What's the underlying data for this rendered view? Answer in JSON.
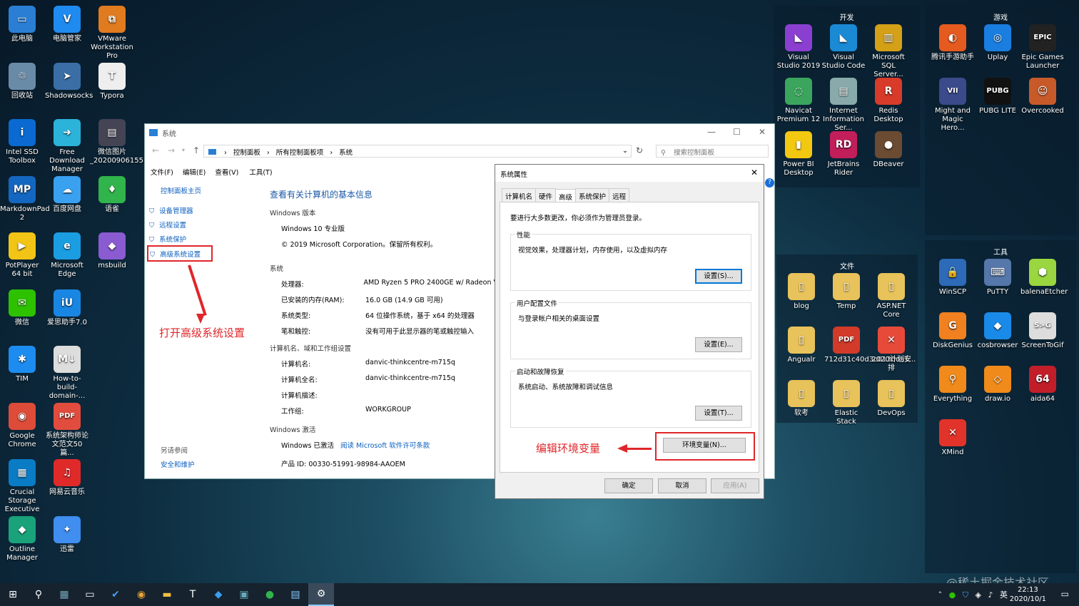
{
  "desktop": {
    "icons": [
      {
        "label": "此电脑",
        "color": "#2a7fd4",
        "glyph": "▭"
      },
      {
        "label": "电脑管家",
        "color": "#1f8bf0",
        "glyph": "V"
      },
      {
        "label": "VMware Workstation Pro",
        "color": "#e07b20",
        "glyph": "⧉"
      },
      {
        "label": "回收站",
        "color": "#6a8ba8",
        "glyph": "♲"
      },
      {
        "label": "Shadowsocks",
        "color": "#3a6ea5",
        "glyph": "➤"
      },
      {
        "label": "Typora",
        "color": "#eeeeee",
        "glyph": "T"
      },
      {
        "label": "Intel SSD Toolbox",
        "color": "#0a6ad1",
        "glyph": "i"
      },
      {
        "label": "Free Download Manager",
        "color": "#2bb3d9",
        "glyph": "➜"
      },
      {
        "label": "微信图片_20200906155...",
        "color": "#445",
        "glyph": "▤"
      },
      {
        "label": "MarkdownPad 2",
        "color": "#1467c0",
        "glyph": "MP"
      },
      {
        "label": "百度网盘",
        "color": "#3aa0f0",
        "glyph": "☁"
      },
      {
        "label": "语雀",
        "color": "#31b44b",
        "glyph": "♦"
      },
      {
        "label": "PotPlayer 64 bit",
        "color": "#f2c416",
        "glyph": "▶"
      },
      {
        "label": "Microsoft Edge",
        "color": "#1b9de2",
        "glyph": "e"
      },
      {
        "label": "msbuild",
        "color": "#8a5bd1",
        "glyph": "◆"
      },
      {
        "label": "微信",
        "color": "#2dc100",
        "glyph": "✉"
      },
      {
        "label": "爱思助手7.0",
        "color": "#1a86e3",
        "glyph": "iU"
      },
      {
        "label": "TIM",
        "color": "#1d8cf0",
        "glyph": "✱"
      },
      {
        "label": "How-to-build-domain-...",
        "color": "#ddd",
        "glyph": "M↓"
      },
      {
        "label": "Google Chrome",
        "color": "#dd4b39",
        "glyph": "◉"
      },
      {
        "label": "系统架构师论文范文50篇...",
        "color": "#e24c3e",
        "glyph": "PDF"
      },
      {
        "label": "Crucial Storage Executive",
        "color": "#0a7bc5",
        "glyph": "▦"
      },
      {
        "label": "网易云音乐",
        "color": "#e02a2a",
        "glyph": "♫"
      },
      {
        "label": "Outline Manager",
        "color": "#1aa37b",
        "glyph": "◆"
      },
      {
        "label": "迅雷",
        "color": "#3f8ef0",
        "glyph": "✦"
      }
    ]
  },
  "groups": {
    "dev": {
      "title": "开发",
      "items": [
        {
          "label": "Visual Studio 2019",
          "color": "#8a3fd1",
          "glyph": "◣"
        },
        {
          "label": "Visual Studio Code",
          "color": "#1a8ad4",
          "glyph": "◣"
        },
        {
          "label": "Microsoft SQL Server...",
          "color": "#d4a017",
          "glyph": "▥"
        },
        {
          "label": "Navicat Premium 12",
          "color": "#3ba55d",
          "glyph": "◌"
        },
        {
          "label": "Internet Information Ser...",
          "color": "#8aa",
          "glyph": "▤"
        },
        {
          "label": "Redis Desktop",
          "color": "#d83b2a",
          "glyph": "R"
        },
        {
          "label": "Power BI Desktop",
          "color": "#f2c811",
          "glyph": "▮"
        },
        {
          "label": "JetBrains Rider",
          "color": "#c21e5a",
          "glyph": "RD"
        },
        {
          "label": "DBeaver",
          "color": "#6b4b32",
          "glyph": "●"
        }
      ]
    },
    "games": {
      "title": "游戏",
      "items": [
        {
          "label": "腾讯手游助手",
          "color": "#e55a1f",
          "glyph": "◐"
        },
        {
          "label": "Uplay",
          "color": "#1a7ee0",
          "glyph": "◎"
        },
        {
          "label": "Epic Games Launcher",
          "color": "#222",
          "glyph": "EPIC"
        },
        {
          "label": "Might and Magic Hero...",
          "color": "#3a4a8a",
          "glyph": "VII"
        },
        {
          "label": "PUBG LITE",
          "color": "#111",
          "glyph": "PUBG"
        },
        {
          "label": "Overcooked",
          "color": "#c85a2a",
          "glyph": "☺"
        }
      ]
    },
    "files": {
      "title": "文件",
      "items": [
        {
          "label": "blog",
          "color": "#e8c25a",
          "glyph": "▯"
        },
        {
          "label": "Temp",
          "color": "#e8c25a",
          "glyph": "▯"
        },
        {
          "label": "ASP.NET Core",
          "color": "#e8c25a",
          "glyph": "▯"
        },
        {
          "label": "Angualr",
          "color": "#e8c25a",
          "glyph": "▯"
        },
        {
          "label": "712d31c40d3c0130ea1...",
          "color": "#d23a2a",
          "glyph": "PDF"
        },
        {
          "label": "2020计划安排",
          "color": "#e84a3a",
          "glyph": "✕"
        },
        {
          "label": "软考",
          "color": "#e8c25a",
          "glyph": "▯"
        },
        {
          "label": "Elastic Stack",
          "color": "#e8c25a",
          "glyph": "▯"
        },
        {
          "label": "DevOps",
          "color": "#e8c25a",
          "glyph": "▯"
        }
      ]
    },
    "tools": {
      "title": "工具",
      "items": [
        {
          "label": "WinSCP",
          "color": "#2d6ab8",
          "glyph": "🔒"
        },
        {
          "label": "PuTTY",
          "color": "#5577aa",
          "glyph": "⌨"
        },
        {
          "label": "balenaEtcher",
          "color": "#9ad640",
          "glyph": "⬢"
        },
        {
          "label": "DiskGenius",
          "color": "#f08020",
          "glyph": "G"
        },
        {
          "label": "cosbrowser",
          "color": "#1a8ae8",
          "glyph": "◆"
        },
        {
          "label": "ScreenToGif",
          "color": "#ddd",
          "glyph": "S>G"
        },
        {
          "label": "Everything",
          "color": "#f08a1a",
          "glyph": "⚲"
        },
        {
          "label": "draw.io",
          "color": "#f08a1a",
          "glyph": "◇"
        },
        {
          "label": "aida64",
          "color": "#c21e2a",
          "glyph": "64"
        },
        {
          "label": "XMind",
          "color": "#e2332a",
          "glyph": "✕"
        }
      ]
    }
  },
  "system_window": {
    "title": "系统",
    "address": {
      "part1": "控制面板",
      "part2": "所有控制面板项",
      "part3": "系统"
    },
    "search_placeholder": "搜索控制面板",
    "menu": [
      "文件(F)",
      "编辑(E)",
      "查看(V)",
      "工具(T)"
    ],
    "sidebar": {
      "home": "控制面板主页",
      "items": [
        "设备管理器",
        "远程设置",
        "系统保护",
        "高级系统设置"
      ],
      "see_also": "另请参阅",
      "security": "安全和维护"
    },
    "heading": "查看有关计算机的基本信息",
    "edition_header": "Windows 版本",
    "edition": "Windows 10 专业版",
    "copyright": "© 2019 Microsoft Corporation。保留所有权利。",
    "system_header": "系统",
    "system_rows": [
      {
        "k": "处理器:",
        "v": "AMD Ryzen 5 PRO 2400GE w/ Radeon V"
      },
      {
        "k": "已安装的内存(RAM):",
        "v": "16.0 GB (14.9 GB 可用)"
      },
      {
        "k": "系统类型:",
        "v": "64 位操作系统，基于 x64 的处理器"
      },
      {
        "k": "笔和触控:",
        "v": "没有可用于此显示器的笔或触控输入"
      }
    ],
    "computer_header": "计算机名、域和工作组设置",
    "computer_rows": [
      {
        "k": "计算机名:",
        "v": "danvic-thinkcentre-m715q"
      },
      {
        "k": "计算机全名:",
        "v": "danvic-thinkcentre-m715q"
      },
      {
        "k": "计算机描述:",
        "v": ""
      },
      {
        "k": "工作组:",
        "v": "WORKGROUP"
      }
    ],
    "activation_header": "Windows 激活",
    "activated": "Windows 已激活",
    "license_link": "阅读 Microsoft 软件许可条款",
    "product_id": "产品 ID: 00330-51991-98984-AAOEM",
    "annotation": "打开高级系统设置"
  },
  "props_dialog": {
    "title": "系统属性",
    "tabs": [
      "计算机名",
      "硬件",
      "高级",
      "系统保护",
      "远程"
    ],
    "admin_note": "要进行大多数更改，你必须作为管理员登录。",
    "perf": {
      "legend": "性能",
      "desc": "视觉效果，处理器计划，内存使用，以及虚拟内存",
      "button": "设置(S)..."
    },
    "profile": {
      "legend": "用户配置文件",
      "desc": "与登录帐户相关的桌面设置",
      "button": "设置(E)..."
    },
    "startup": {
      "legend": "启动和故障恢复",
      "desc": "系统启动、系统故障和调试信息",
      "button": "设置(T)..."
    },
    "env_button": "环境变量(N)...",
    "annotation": "编辑环境变量",
    "ok": "确定",
    "cancel": "取消",
    "apply": "应用(A)"
  },
  "taskbar": {
    "clock_time": "22:13",
    "clock_date": "2020/10/1",
    "ime": "英",
    "watermark": "@稀土掘金技术社区"
  }
}
